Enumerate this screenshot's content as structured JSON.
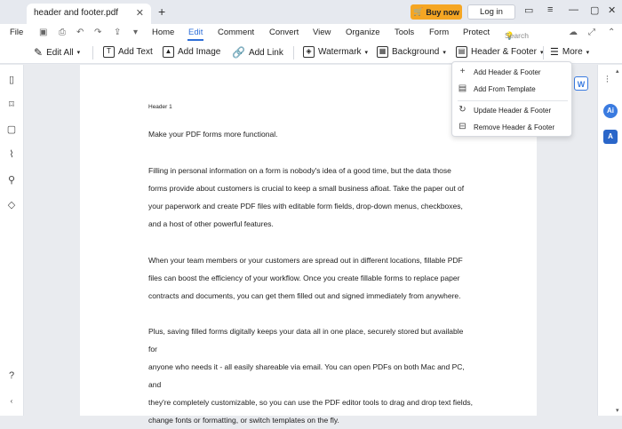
{
  "tab": {
    "title": "header and footer.pdf",
    "close": "✕",
    "new": "+"
  },
  "titlebar": {
    "buy_now": "Buy now",
    "login": "Log in"
  },
  "menu": {
    "items": [
      "File",
      "Home",
      "Edit",
      "Comment",
      "Convert",
      "View",
      "Organize",
      "Tools",
      "Form",
      "Protect"
    ],
    "search": "Search Tools"
  },
  "toolbar": {
    "edit_all": "Edit All",
    "add_text": "Add Text",
    "add_image": "Add Image",
    "add_link": "Add Link",
    "watermark": "Watermark",
    "background": "Background",
    "header_footer": "Header & Footer",
    "more": "More"
  },
  "dropdown": {
    "items": [
      "Add Header & Footer",
      "Add From Template",
      "Update Header & Footer",
      "Remove Header & Footer"
    ]
  },
  "document": {
    "header": "Header 1",
    "p1": "Make your PDF forms more functional.",
    "p2_lines": [
      "Filling in personal information on a form is nobody's idea of a good time, but the data those",
      "forms provide about customers is crucial to keep a small business afloat. Take the paper out of",
      "your paperwork and create PDF files with editable form fields, drop-down menus, checkboxes,",
      "and a host of other powerful features."
    ],
    "p3_lines": [
      "When your team members or your customers are spread out in different locations, fillable PDF",
      "files can boost the efficiency of your workflow. Once you create fillable forms to replace paper",
      "contracts and documents, you can get them filled out and signed immediately from anywhere."
    ],
    "p4_lines": [
      "Plus, saving filled forms digitally keeps your data all in one place, securely stored but available for",
      "anyone who needs it - all easily shareable via email. You can open PDFs on both Mac and PC, and",
      "they're completely customizable, so you can use the PDF editor tools to drag and drop text fields,",
      "change fonts or formatting, or switch templates on the fly."
    ]
  },
  "right_panel": {
    "ai_label": "Ai",
    "translate_label": "A"
  },
  "colors": {
    "accent": "#2f6fd8",
    "buy": "#f5a623"
  }
}
